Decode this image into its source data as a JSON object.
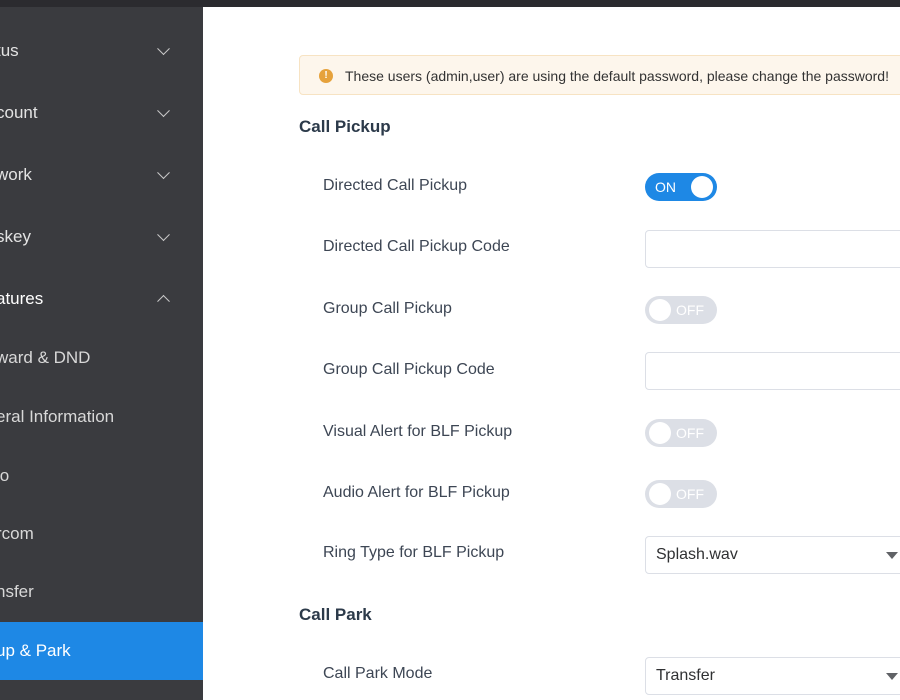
{
  "sidebar": {
    "items": [
      {
        "label": "tus",
        "state": "collapsed"
      },
      {
        "label": "count",
        "state": "collapsed"
      },
      {
        "label": "work",
        "state": "collapsed"
      },
      {
        "label": "skey",
        "state": "collapsed"
      },
      {
        "label": "atures",
        "state": "expanded"
      },
      {
        "label": "ward & DND"
      },
      {
        "label": "eral Information"
      },
      {
        "label": "io"
      },
      {
        "label": "rcom"
      },
      {
        "label": "nsfer"
      },
      {
        "label": "up & Park",
        "active": true
      }
    ]
  },
  "warning": {
    "icon": "exclamation-icon",
    "text": "These users (admin,user) are using the default password, please change the password!"
  },
  "call_pickup": {
    "title": "Call Pickup",
    "directed_call_pickup": {
      "label": "Directed Call Pickup",
      "state": "ON"
    },
    "directed_call_pickup_code": {
      "label": "Directed Call Pickup Code",
      "value": ""
    },
    "group_call_pickup": {
      "label": "Group Call Pickup",
      "state": "OFF"
    },
    "group_call_pickup_code": {
      "label": "Group Call Pickup Code",
      "value": ""
    },
    "visual_alert_blf": {
      "label": "Visual Alert for BLF Pickup",
      "state": "OFF"
    },
    "audio_alert_blf": {
      "label": "Audio Alert for BLF Pickup",
      "state": "OFF"
    },
    "ring_type_blf": {
      "label": "Ring Type for BLF Pickup",
      "value": "Splash.wav"
    }
  },
  "call_park": {
    "title": "Call Park",
    "call_park_mode": {
      "label": "Call Park Mode",
      "value": "Transfer"
    }
  },
  "colors": {
    "accent": "#1e88e5",
    "sidebar_bg": "#3a3b3f",
    "warning_icon": "#e6a23c",
    "warning_bg": "#fdf6ec"
  }
}
